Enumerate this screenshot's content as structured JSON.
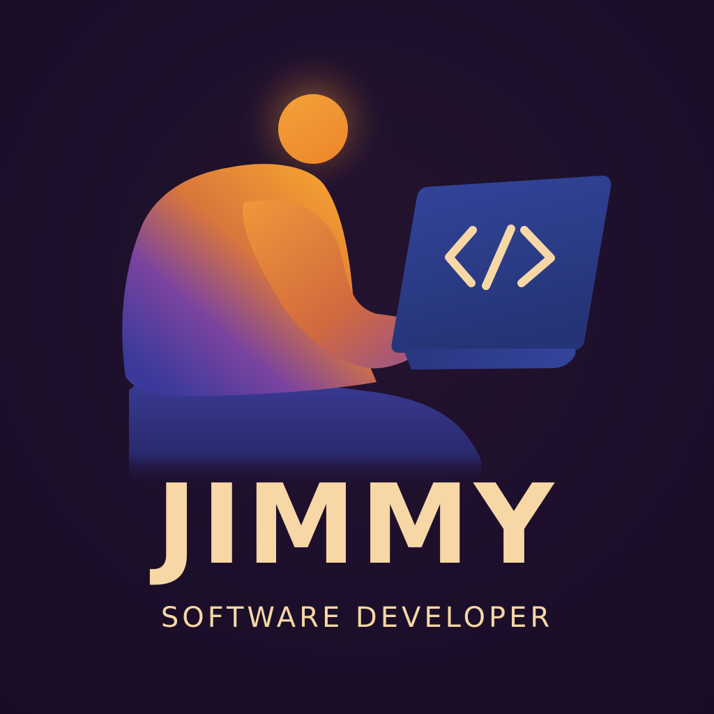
{
  "logo": {
    "name": "JIMMY",
    "tagline": "SOFTWARE DEVELOPER",
    "screen_glyph": "</>",
    "colors": {
      "background": "#1d0f2b",
      "text": "#f6d7a5",
      "figure_warm": "#f5a030",
      "figure_cool": "#3b3a9a",
      "laptop": "#2f3d92"
    },
    "icons": [
      "person-figure-icon",
      "laptop-icon",
      "code-brackets-icon"
    ]
  }
}
